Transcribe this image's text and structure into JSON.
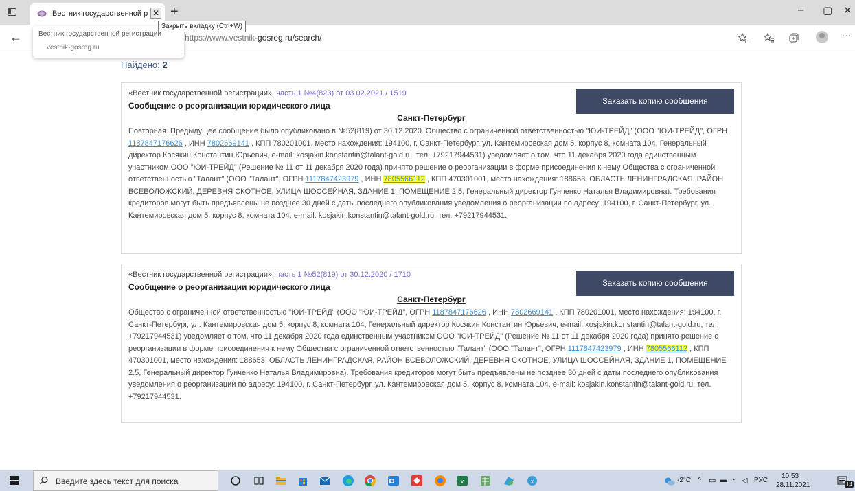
{
  "browser": {
    "tab_title": "Вестник государственной реги",
    "tab_close": "✕",
    "new_tab": "+",
    "tooltip": "Закрыть вкладку (Ctrl+W)",
    "preview_title": "Вестник государственной регистрации",
    "preview_domain": "vestnik-gosreg.ru",
    "address_faded": "https://www.vestnik-",
    "address_main": "gosreg.ru/search/",
    "minimize": "–",
    "maximize": "▢",
    "close": "✕",
    "back": "←",
    "more": "···"
  },
  "page": {
    "found_label": "Найдено:",
    "found_count": "2"
  },
  "cards": [
    {
      "meta_source": "«Вестник государственной регистрации».",
      "meta_issue": "часть 1 №4(823) от 03.02.2021 / 1519",
      "heading": "Сообщение о реорганизации юридического лица",
      "button": "Заказать копию сообщения",
      "city": "Санкт-Петербург",
      "t1": "Повторная. Предыдущее сообщение было опубликовано в №52(819) от 30.12.2020. Общество с ограниченной ответственностью \"ЮИ-ТРЕЙД\" (ООО \"ЮИ-ТРЕЙД\", ОГРН ",
      "ogrn1": "1187847176626",
      "t2": " , ИНН ",
      "inn1": "7802669141",
      "t3": " , КПП 780201001, место нахождения: 194100, г. Санкт-Петербург, ул. Кантемировская дом 5, корпус 8, комната 104, Генеральный директор Косякин Константин Юрьевич, e-mail: kosjakin.konstantin@talant-gold.ru, тел. +79217944531) уведомляет о том, что 11 декабря 2020 года единственным участником ООО \"ЮИ-ТРЕЙД\" (Решение № 11 от 11 декабря 2020 года) принято решение о реорганизации в форме присоединения к нему Общества с ограниченной ответственностью \"Талант\" (ООО \"Талант\", ОГРН ",
      "ogrn2": "1117847423979",
      "t4": " , ИНН ",
      "inn2": "7805566112",
      "t5": " , КПП 470301001, место нахождения: 188653, ОБЛАСТЬ ЛЕНИНГРАДСКАЯ, РАЙОН ВСЕВОЛОЖСКИЙ, ДЕРЕВНЯ СКОТНОЕ, УЛИЦА ШОССЕЙНАЯ, ЗДАНИЕ 1, ПОМЕЩЕНИЕ 2.5, Генеральный директор Гунченко Наталья Владимировна). Требования кредиторов могут быть предъявлены не позднее 30 дней с даты последнего опубликования уведомления о реорганизации по адресу: 194100, г. Санкт-Петербург, ул. Кантемировская дом 5, корпус 8, комната 104, e-mail: kosjakin.konstantin@talant-gold.ru, тел. +79217944531."
    },
    {
      "meta_source": "«Вестник государственной регистрации».",
      "meta_issue": "часть 1 №52(819) от 30.12.2020 / 1710",
      "heading": "Сообщение о реорганизации юридического лица",
      "button": "Заказать копию сообщения",
      "city": "Санкт-Петербург",
      "t1": "Общество с ограниченной ответственностью \"ЮИ-ТРЕЙД\" (ООО \"ЮИ-ТРЕЙД\", ОГРН ",
      "ogrn1": "1187847176626",
      "t2": " , ИНН ",
      "inn1": "7802669141",
      "t3": " , КПП 780201001, место нахождения: 194100, г. Санкт-Петербург, ул. Кантемировская дом 5, корпус 8, комната 104, Генеральный директор Косякин Константин Юрьевич, e-mail: kosjakin.konstantin@talant-gold.ru, тел. +79217944531) уведомляет о том, что 11 декабря 2020 года единственным участником ООО \"ЮИ-ТРЕЙД\" (Решение № 11 от 11 декабря 2020 года) принято решение о реорганизации в форме присоединения к нему Общества с ограниченной ответственностью \"Талант\" (ООО \"Талант\", ОГРН ",
      "ogrn2": "1117847423979",
      "t4": " , ИНН ",
      "inn2": "7805566112",
      "t5": " , КПП 470301001, место нахождения: 188653, ОБЛАСТЬ ЛЕНИНГРАДСКАЯ, РАЙОН ВСЕВОЛОЖСКИЙ, ДЕРЕВНЯ СКОТНОЕ, УЛИЦА ШОССЕЙНАЯ, ЗДАНИЕ 1, ПОМЕЩЕНИЕ 2.5, Генеральный директор Гунченко Наталья Владимировна). Требования кредиторов могут быть предъявлены не позднее 30 дней с даты последнего опубликования уведомления о реорганизации по адресу: 194100, г. Санкт-Петербург, ул. Кантемировская дом 5, корпус 8, комната 104, e-mail: kosjakin.konstantin@talant-gold.ru, тел. +79217944531."
    }
  ],
  "taskbar": {
    "search_placeholder": "Введите здесь текст для поиска",
    "weather": "-2°C",
    "language": "РУС",
    "time": "10:53",
    "date": "28.11.2021",
    "notifications": "14"
  },
  "colors": {
    "button_bg": "#3d4965",
    "link": "#3d8fd6",
    "highlight": "#ffff3a",
    "issue_text": "#7a6ad0"
  }
}
